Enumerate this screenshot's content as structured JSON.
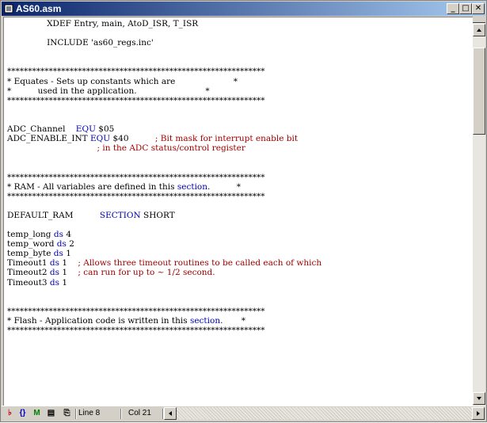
{
  "window": {
    "title": "AS60.asm"
  },
  "code": [
    [
      {
        "t": "               XDEF Entry, main, AtoD_ISR, T_ISR"
      }
    ],
    [
      {
        "t": ""
      }
    ],
    [
      {
        "t": "               INCLUDE 'as60_regs.inc'"
      }
    ],
    [
      {
        "t": ""
      }
    ],
    [
      {
        "t": ""
      }
    ],
    [
      {
        "t": "**************************************************************"
      }
    ],
    [
      {
        "t": "* Equates - Sets up constants which are                      *"
      }
    ],
    [
      {
        "t": "*          used in the application.                          *"
      }
    ],
    [
      {
        "t": "**************************************************************"
      }
    ],
    [
      {
        "t": ""
      }
    ],
    [
      {
        "t": ""
      }
    ],
    [
      {
        "t": "ADC_Channel    "
      },
      {
        "t": "EQU",
        "c": "kw"
      },
      {
        "t": " $05"
      }
    ],
    [
      {
        "t": "ADC_ENABLE_INT "
      },
      {
        "t": "EQU",
        "c": "kw"
      },
      {
        "t": " $40          "
      },
      {
        "t": "; Bit mask for interrupt enable bit",
        "c": "cm"
      }
    ],
    [
      {
        "t": "                                  "
      },
      {
        "t": "; in the ADC status/control register",
        "c": "cm"
      }
    ],
    [
      {
        "t": ""
      }
    ],
    [
      {
        "t": ""
      }
    ],
    [
      {
        "t": "**************************************************************"
      }
    ],
    [
      {
        "t": "* RAM - All variables are defined in this "
      },
      {
        "t": "section",
        "c": "kw"
      },
      {
        "t": ".          *"
      }
    ],
    [
      {
        "t": "**************************************************************"
      }
    ],
    [
      {
        "t": ""
      }
    ],
    [
      {
        "t": "DEFAULT_RAM          "
      },
      {
        "t": "SECTION",
        "c": "kw"
      },
      {
        "t": " SHORT"
      }
    ],
    [
      {
        "t": ""
      }
    ],
    [
      {
        "t": "temp_long "
      },
      {
        "t": "ds",
        "c": "kw"
      },
      {
        "t": " 4"
      }
    ],
    [
      {
        "t": "temp_word "
      },
      {
        "t": "ds",
        "c": "kw"
      },
      {
        "t": " 2"
      }
    ],
    [
      {
        "t": "temp_byte "
      },
      {
        "t": "ds",
        "c": "kw"
      },
      {
        "t": " 1"
      }
    ],
    [
      {
        "t": "Timeout1 "
      },
      {
        "t": "ds",
        "c": "kw"
      },
      {
        "t": " 1    "
      },
      {
        "t": "; Allows three timeout routines to be called each of which",
        "c": "cm"
      }
    ],
    [
      {
        "t": "Timeout2 "
      },
      {
        "t": "ds",
        "c": "kw"
      },
      {
        "t": " 1    "
      },
      {
        "t": "; can run for up to ~ 1/2 second.",
        "c": "cm"
      }
    ],
    [
      {
        "t": "Timeout3 "
      },
      {
        "t": "ds",
        "c": "kw"
      },
      {
        "t": " 1"
      }
    ],
    [
      {
        "t": ""
      }
    ],
    [
      {
        "t": ""
      }
    ],
    [
      {
        "t": "**************************************************************"
      }
    ],
    [
      {
        "t": "* Flash - Application code is written in this "
      },
      {
        "t": "section",
        "c": "kw"
      },
      {
        "t": ".       *"
      }
    ],
    [
      {
        "t": "**************************************************************"
      }
    ]
  ],
  "status": {
    "line": "Line 8",
    "col": "Col 21"
  },
  "icons": [
    "document-icon",
    "brace-icon",
    "macro-icon",
    "file-icon",
    "compile-icon"
  ]
}
